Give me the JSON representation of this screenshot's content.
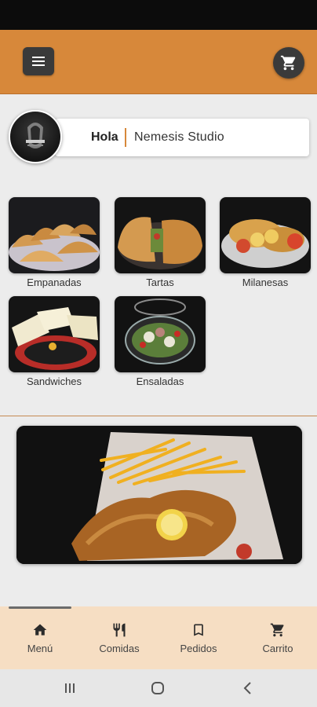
{
  "header": {
    "menu_icon": "hamburger-menu-icon",
    "cart_icon": "shopping-cart-icon",
    "accent": "#d7883a"
  },
  "greeting": {
    "hello": "Hola",
    "user_name": "Nemesis Studio"
  },
  "categories": [
    {
      "label": "Empanadas"
    },
    {
      "label": "Tartas"
    },
    {
      "label": "Milanesas"
    },
    {
      "label": "Sandwiches"
    },
    {
      "label": "Ensaladas"
    }
  ],
  "bottom_nav": {
    "active_index": 0,
    "items": [
      {
        "label": "Menú",
        "icon": "home-icon"
      },
      {
        "label": "Comidas",
        "icon": "cutlery-icon"
      },
      {
        "label": "Pedidos",
        "icon": "bookmark-icon"
      },
      {
        "label": "Carrito",
        "icon": "cart-icon"
      }
    ]
  },
  "colors": {
    "appbar": "#d7883a",
    "bottom_nav_bg": "#f6dec3",
    "button_dark": "#3a3a3a"
  }
}
